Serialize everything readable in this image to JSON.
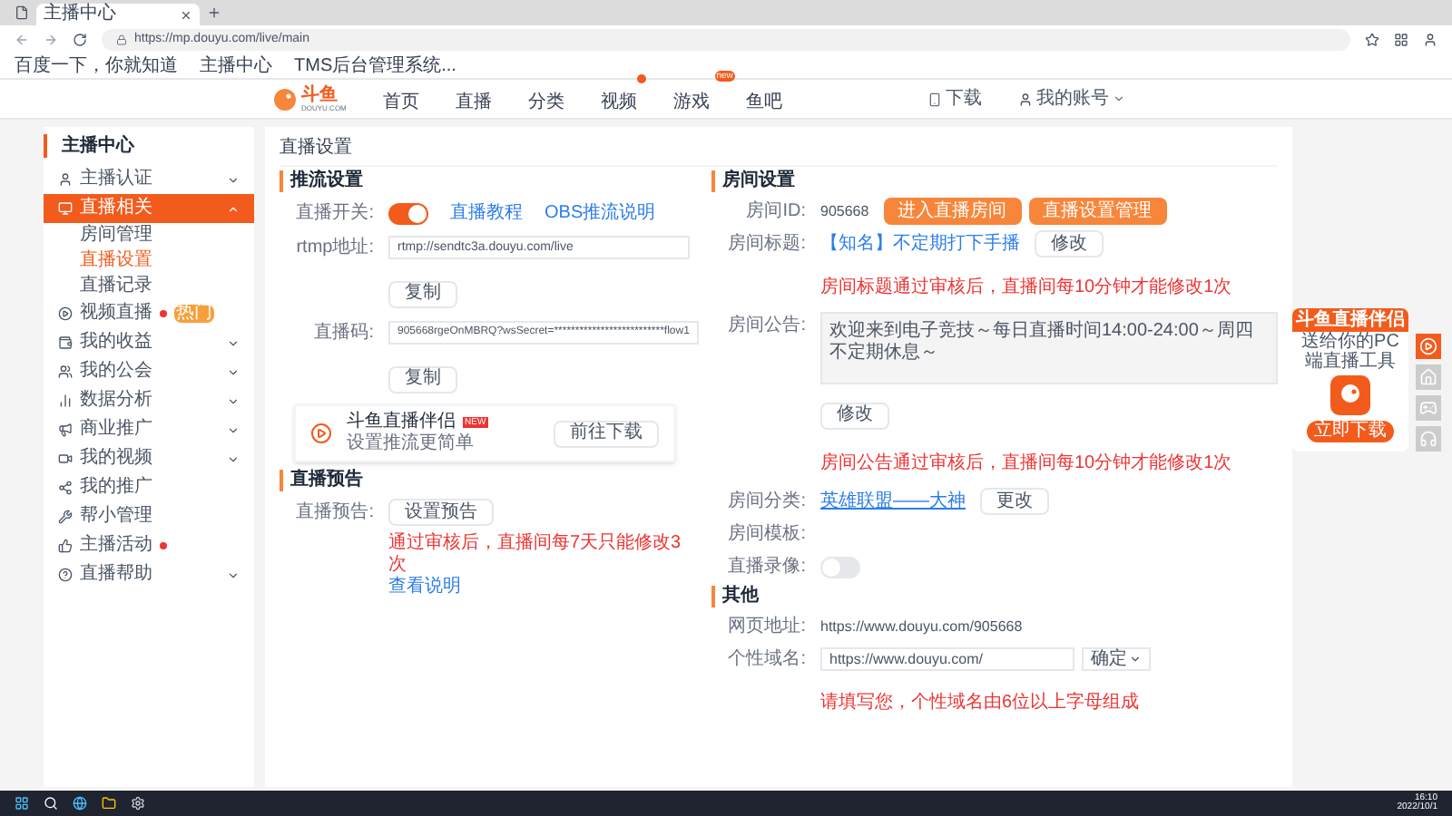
{
  "browser": {
    "tabs": [
      {
        "title": "主播中心",
        "selected": true
      }
    ],
    "address": "https://mp.douyu.com/live/main",
    "bookmarks": [
      "百度一下，你就知道",
      "主播中心",
      "TMS后台管理系统..."
    ]
  },
  "header": {
    "logo": "斗鱼",
    "logo_sub": "DOUYU.COM",
    "nav": [
      {
        "label": "首页"
      },
      {
        "label": "直播"
      },
      {
        "label": "分类"
      },
      {
        "label": "视频",
        "badge": {
          "kind": "dot"
        }
      },
      {
        "label": "游戏",
        "badge": {
          "kind": "tag",
          "text": "new"
        }
      },
      {
        "label": "鱼吧"
      }
    ],
    "download": "下载",
    "user": "我的账号"
  },
  "sidebar": {
    "title": "主播中心",
    "items": [
      {
        "label": "主播认证",
        "selected": false,
        "expanded": false
      },
      {
        "label": "直播相关",
        "selected": true,
        "expanded": true,
        "children": [
          {
            "label": "房间管理",
            "selected": false
          },
          {
            "label": "直播设置",
            "selected": true
          },
          {
            "label": "直播记录",
            "selected": false
          }
        ]
      },
      {
        "label": "视频直播",
        "selected": false,
        "dot": true,
        "tag": "热门"
      },
      {
        "label": "我的收益",
        "selected": false,
        "expanded": false
      },
      {
        "label": "我的公会",
        "selected": false,
        "expanded": false
      },
      {
        "label": "数据分析",
        "selected": false,
        "expanded": false
      },
      {
        "label": "商业推广",
        "selected": false,
        "expanded": false
      },
      {
        "label": "我的视频",
        "selected": false,
        "expanded": false
      },
      {
        "label": "我的推广",
        "selected": false
      },
      {
        "label": "帮小管理",
        "selected": false
      },
      {
        "label": "主播活动",
        "selected": false,
        "dot": true
      },
      {
        "label": "直播帮助",
        "selected": false,
        "expanded": false
      }
    ]
  },
  "main": {
    "title": "直播设置",
    "stream": {
      "heading": "推流设置",
      "switch_label": "直播开关:",
      "live_on": true,
      "links": [
        "直播教程",
        "OBS推流说明"
      ],
      "rtmp_label": "rtmp地址:",
      "rtmp": "rtmp://sendtc3a.douyu.com/live",
      "copy1": "复制",
      "code_label": "直播码:",
      "code": "905668rgeOnMBRQ?wsSecret=**************************flow1",
      "copy2": "复制",
      "app_title": "斗鱼直播伴侣",
      "app_tag": "NEW",
      "app_sub": "设置推流更简单",
      "app_button": "前往下载"
    },
    "preview": {
      "heading": "直播预告",
      "label": "直播预告:",
      "button": "设置预告",
      "note": "通过审核后，直播间每7天只能修改3次",
      "link": "查看说明"
    },
    "room": {
      "heading": "房间设置",
      "id_label": "房间ID:",
      "id": "905668",
      "buttons": [
        "进入直播房间",
        "直播设置管理"
      ],
      "title_label": "房间标题:",
      "title": "【知名】不定期打下手播",
      "title_button": "修改",
      "title_note": "房间标题通过审核后，直播间每10分钟才能修改1次",
      "notice_label": "房间公告:",
      "notice": "欢迎来到电子竞技～每日直播时间14:00-24:00～周四不定期休息～",
      "notice_button": "修改",
      "notice_note": "房间公告通过审核后，直播间每10分钟才能修改1次",
      "category_label": "房间分类:",
      "category": "英雄联盟——大神",
      "category_button": "更改",
      "template_label": "房间模板:",
      "record_label": "直播录像:",
      "record_on": false
    },
    "other": {
      "heading": "其他",
      "web_label": "网页地址:",
      "web": "https://www.douyu.com/905668",
      "domain_label": "个性域名:",
      "domain": "https://www.douyu.com/",
      "domain_button": "确定",
      "domain_note": "请填写您，个性域名由6位以上字母组成"
    }
  },
  "ad": {
    "title": "斗鱼直播伴侣",
    "sub": "送给你的PC端直播工具",
    "button": "立即下载"
  },
  "taskbar": {
    "time": "16:10",
    "date": "2022/10/1"
  }
}
